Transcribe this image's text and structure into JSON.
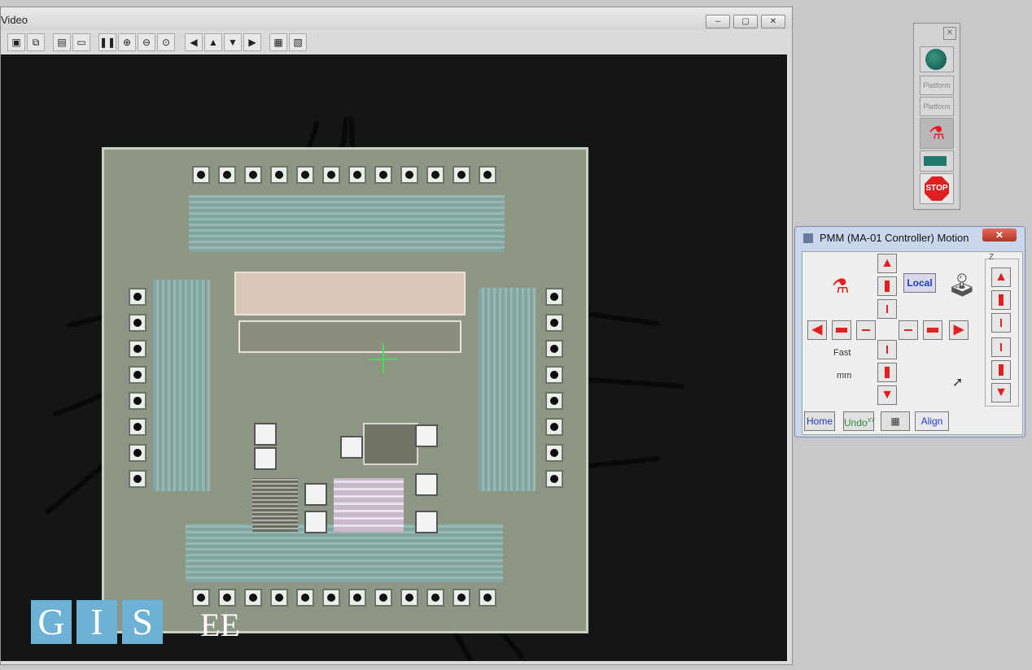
{
  "window": {
    "title": "Video",
    "controls": [
      "minimize",
      "maximize",
      "close"
    ]
  },
  "toolbar": {
    "buttons": [
      {
        "icon": "save-icon",
        "glyph": "▣"
      },
      {
        "icon": "copy-icon",
        "glyph": "⧉"
      },
      {
        "icon": "properties-icon",
        "glyph": "▤"
      },
      {
        "icon": "frame-icon",
        "glyph": "▭"
      },
      {
        "icon": "pause-icon",
        "glyph": "❚❚"
      },
      {
        "icon": "zoom-in-icon",
        "glyph": "⊕"
      },
      {
        "icon": "zoom-out-icon",
        "glyph": "⊖"
      },
      {
        "icon": "zoom-fit-icon",
        "glyph": "⊙"
      },
      {
        "icon": "arrow-left-icon",
        "glyph": "◀"
      },
      {
        "icon": "arrow-up-icon",
        "glyph": "▲"
      },
      {
        "icon": "arrow-down-icon",
        "glyph": "▼"
      },
      {
        "icon": "arrow-right-icon",
        "glyph": "▶"
      },
      {
        "icon": "capture-icon",
        "glyph": "▦"
      },
      {
        "icon": "overlay-icon",
        "glyph": "▧"
      }
    ]
  },
  "logo": {
    "letters": [
      "G",
      "I",
      "S"
    ],
    "suffix": "EE"
  },
  "toolbox": {
    "tools": [
      {
        "icon": "globe-icon",
        "label": ""
      },
      {
        "icon": "platform-icon",
        "label": "Platform"
      },
      {
        "icon": "platform-icon",
        "label": "Platform"
      },
      {
        "icon": "microscope-icon",
        "label": ""
      },
      {
        "icon": "stage-icon",
        "label": ""
      },
      {
        "icon": "stop-icon",
        "label": "STOP"
      }
    ]
  },
  "motion_panel": {
    "title": "PMM (MA-01 Controller) Motion",
    "local_label": "Local",
    "speed_label": "Fast",
    "unit_label": "mm",
    "z_label": "Z",
    "home_label": "Home",
    "undo_label": "Undo",
    "undo_sup": "XY",
    "align_label": "Align"
  },
  "colors": {
    "accent_red": "#e02020",
    "crosshair_green": "#3fe05a",
    "logo_blue": "#6eb1d7"
  }
}
